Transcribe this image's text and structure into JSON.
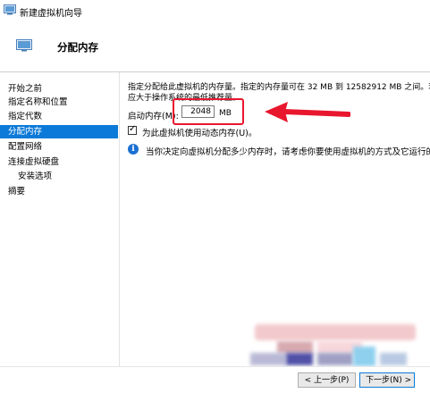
{
  "window": {
    "title": "新建虚拟机向导",
    "app_icon": "hyperv-wizard-icon"
  },
  "header": {
    "icon": "memory-icon",
    "title": "分配内存"
  },
  "sidebar": {
    "items": [
      {
        "label": "开始之前",
        "selected": false
      },
      {
        "label": "指定名称和位置",
        "selected": false
      },
      {
        "label": "指定代数",
        "selected": false
      },
      {
        "label": "分配内存",
        "selected": true
      },
      {
        "label": "配置网络",
        "selected": false
      },
      {
        "label": "连接虚拟硬盘",
        "selected": false
      },
      {
        "label": "安装选项",
        "selected": false,
        "sub": true
      },
      {
        "label": "摘要",
        "selected": false
      }
    ]
  },
  "main": {
    "description_line1": "指定分配给此虚拟机的内存量。指定的内存量可在 32 MB 到 12582912 MB 之间。若要",
    "description_line2": "应大于操作系统的最低推荐量。",
    "startup_memory_label": "启动内存(M):",
    "startup_memory_value": "2048",
    "startup_memory_unit": "MB",
    "dynamic_memory_label": "为此虚拟机使用动态内存(U)。",
    "dynamic_memory_checked": true,
    "info_text": "当你决定向虚拟机分配多少内存时，请考虑你要使用虚拟机的方式及它运行的操",
    "info_icon": "info-icon"
  },
  "annotation": {
    "highlight_color": "#e8172e",
    "arrow_color": "#e8172e"
  },
  "footer": {
    "prev_label": "< 上一步(P)",
    "next_label": "下一步(N) >"
  },
  "colors": {
    "accent": "#0c7ad8",
    "info_blue": "#1a6fd1"
  }
}
